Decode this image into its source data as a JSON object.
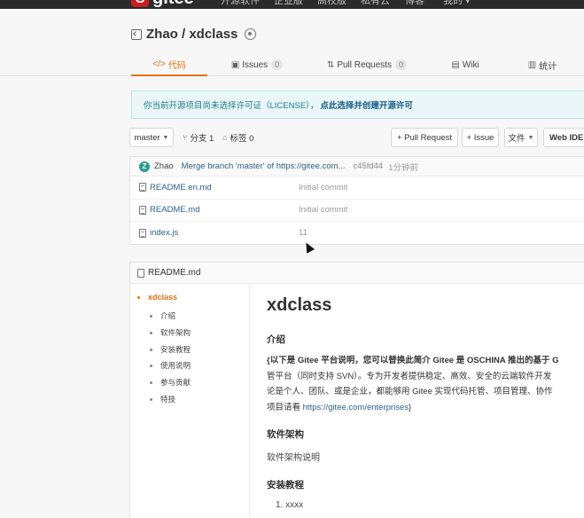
{
  "topnav": {
    "logo_mark": "G",
    "logo_text": "gitee",
    "items": [
      "开源软件",
      "企业版",
      "高校版",
      "私有云",
      "博客",
      "我的 ▾"
    ]
  },
  "repo": {
    "title": "Zhao / xdclass"
  },
  "tabs": [
    {
      "icon": "</>",
      "label": "代码",
      "count": "",
      "active": true
    },
    {
      "icon": "▣",
      "label": "Issues",
      "count": "0",
      "active": false
    },
    {
      "icon": "⇅",
      "label": "Pull Requests",
      "count": "0",
      "active": false
    },
    {
      "icon": "▤",
      "label": "Wiki",
      "count": "",
      "active": false
    },
    {
      "icon": "▥",
      "label": "统计",
      "count": "",
      "active": false
    }
  ],
  "notice": {
    "text": "你当前开源项目尚未选择许可证（LICENSE），",
    "link": "点此选择并创建开源许可"
  },
  "toolbar": {
    "branch": "master",
    "branches": "分支 1",
    "tags": "标签 0",
    "pull_request": "+ Pull Request",
    "issue": "+ Issue",
    "files": "文件",
    "web_ide": "Web IDE"
  },
  "commit": {
    "avatar": "Z",
    "author": "Zhao",
    "message": "Merge branch 'master' of https://gitee.com...",
    "hash": "c45fd44",
    "time": "1分钟前"
  },
  "files": [
    {
      "name": "README.en.md",
      "commit": "Initial commit"
    },
    {
      "name": "README.md",
      "commit": "Initial commit"
    },
    {
      "name": "index.js",
      "commit": "11"
    }
  ],
  "readme": {
    "header": "README.md",
    "toc": [
      "xdclass",
      "介绍",
      "软件架构",
      "安装教程",
      "使用说明",
      "参与贡献",
      "特技"
    ],
    "title": "xdclass",
    "intro_heading": "介绍",
    "intro_lines": [
      "{以下是 Gitee 平台说明，您可以替换此简介 Gitee 是 OSCHINA 推出的基于 G",
      "管平台（同时支持 SVN）。专为开发者提供稳定、高效、安全的云端软件开发",
      "论是个人、团队、或是企业，都能够用 Gitee 实现代码托管、项目管理、协作"
    ],
    "intro_last_prefix": "项目请看 ",
    "intro_link": "https://gitee.com/enterprises",
    "intro_last_suffix": "}",
    "arch_heading": "软件架构",
    "arch_text": "软件架构说明",
    "install_heading": "安装教程",
    "install_item": "1. xxxx"
  }
}
